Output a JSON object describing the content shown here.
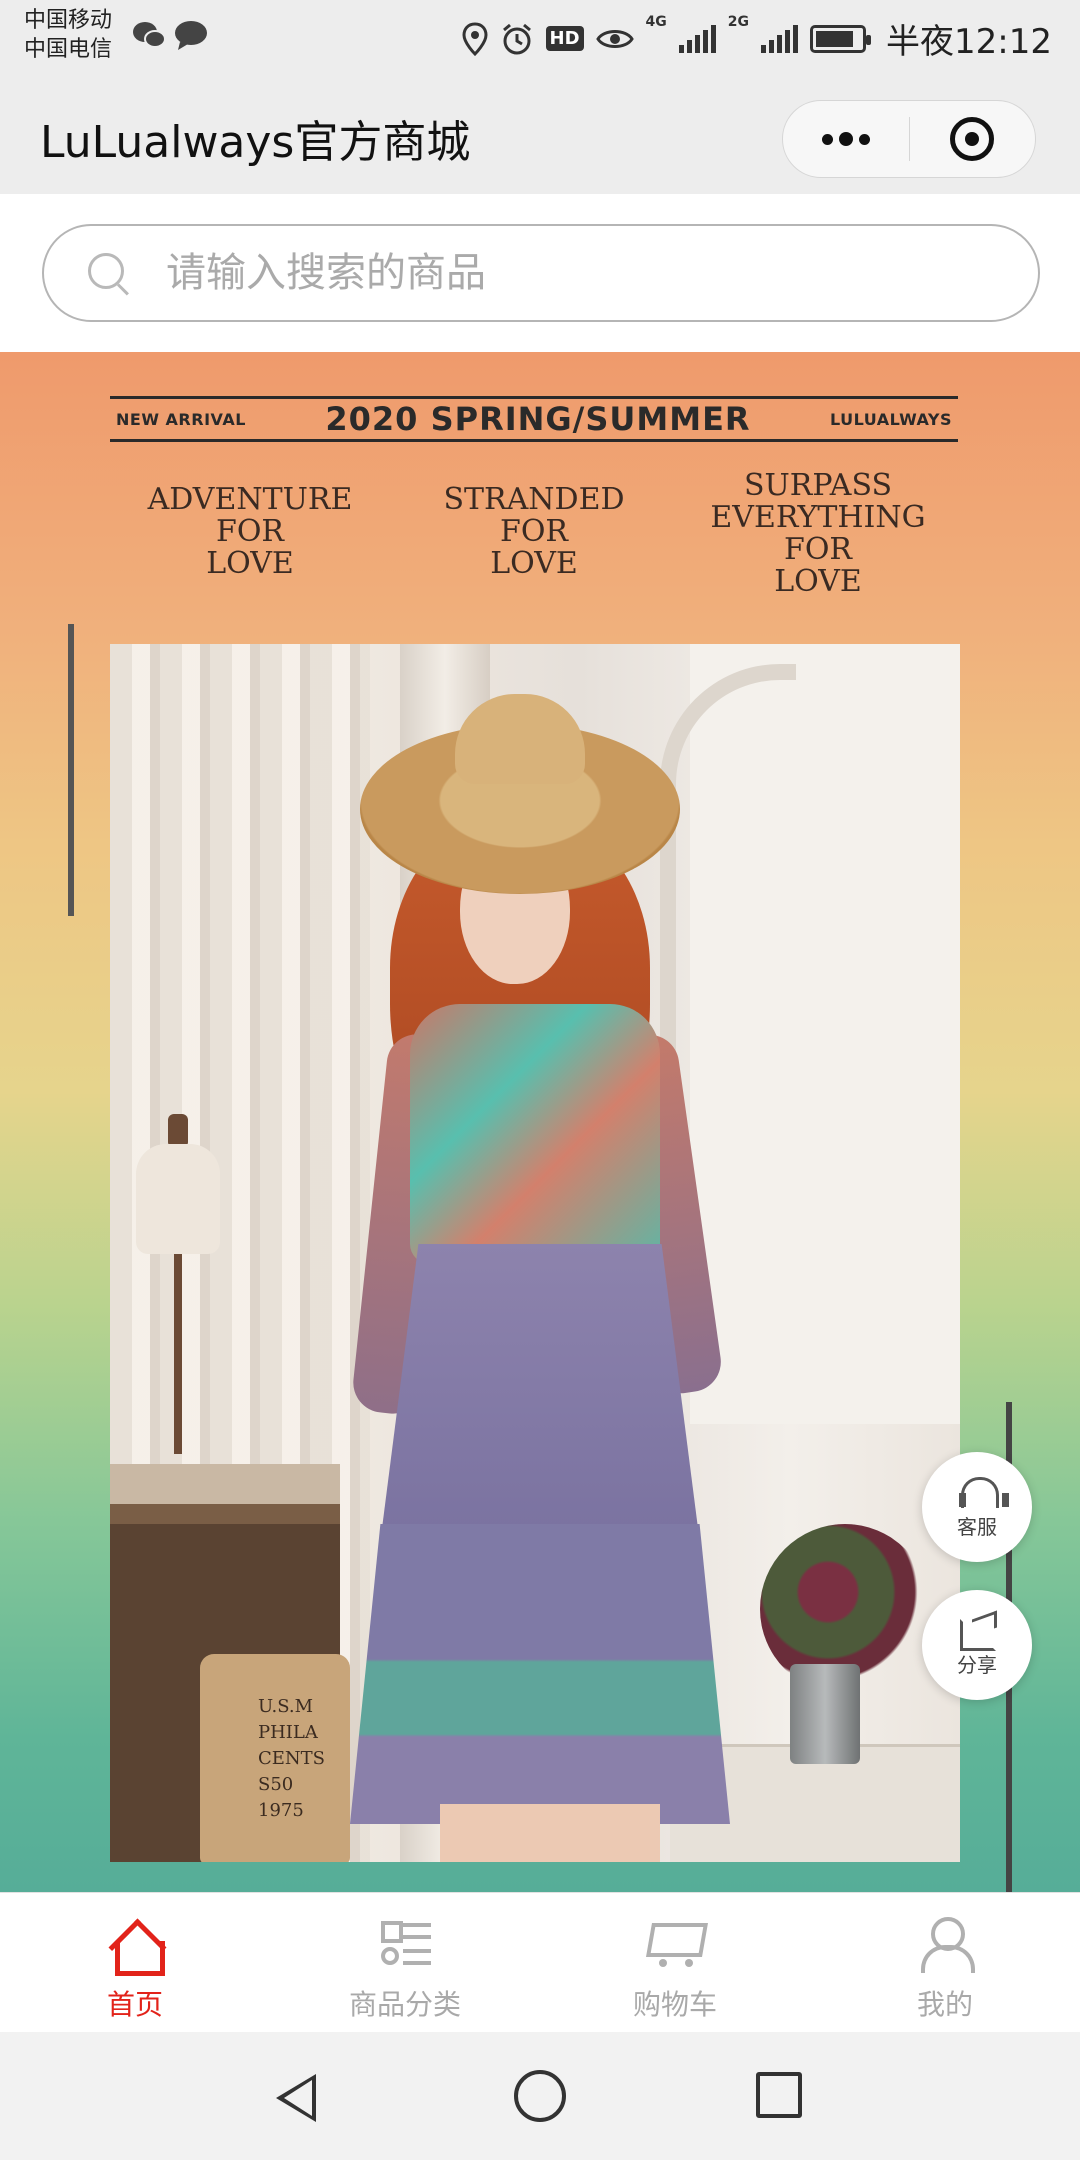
{
  "status_bar": {
    "carrier1": "中国移动",
    "carrier2": "中国电信",
    "hd": "HD",
    "net1": "4G",
    "net2": "2G",
    "time": "半夜12:12",
    "battery_level": 0.85
  },
  "navbar": {
    "title": "LuLualways官方商城"
  },
  "search": {
    "placeholder": "请输入搜索的商品",
    "value": ""
  },
  "banner": {
    "left_tag": "NEW ARRIVAL",
    "headline": "2020 SPRING/SUMMER",
    "right_tag": "LULUALWAYS",
    "slogans": [
      "ADVENTURE\nFOR\nLOVE",
      "STRANDED\nFOR\nLOVE",
      "SURPASS\nEVERYTHING\nFOR\nLOVE"
    ],
    "sack_text": "U.S.M\nPHILA\nCENTS\nS50\n1975",
    "colors": {
      "top": "#ef9a6c",
      "middle": "#e6d48c",
      "bottom": "#56ad98"
    }
  },
  "floating": {
    "service_label": "客服",
    "share_label": "分享"
  },
  "tabbar": {
    "active_color": "#e2231a",
    "items": [
      {
        "label": "首页",
        "icon": "home-icon",
        "active": true
      },
      {
        "label": "商品分类",
        "icon": "category-icon",
        "active": false
      },
      {
        "label": "购物车",
        "icon": "cart-icon",
        "active": false
      },
      {
        "label": "我的",
        "icon": "user-icon",
        "active": false
      }
    ]
  }
}
